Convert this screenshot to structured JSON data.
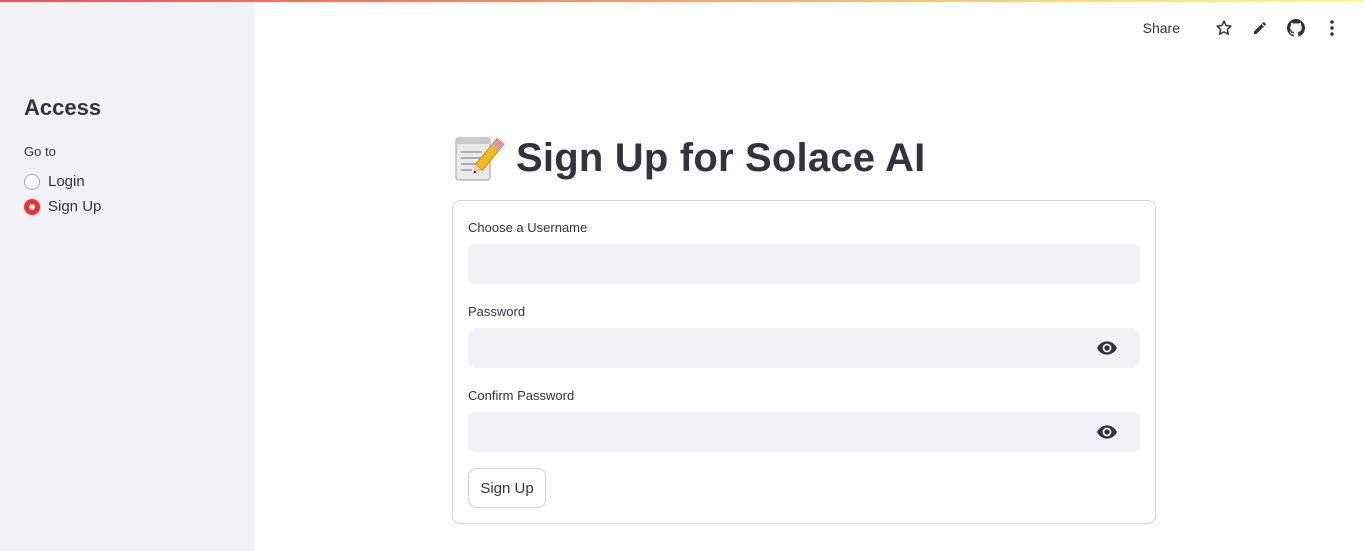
{
  "sidebar": {
    "title": "Access",
    "nav_label": "Go to",
    "options": [
      {
        "label": "Login",
        "selected": false
      },
      {
        "label": "Sign Up",
        "selected": true
      }
    ]
  },
  "toolbar": {
    "share_label": "Share",
    "icons": [
      "star-icon",
      "pencil-icon",
      "github-icon",
      "more-vertical-icon"
    ]
  },
  "main": {
    "title_emoji": "memo-icon",
    "title": "Sign Up for Solace AI",
    "form": {
      "username_label": "Choose a Username",
      "username_value": "",
      "password_label": "Password",
      "password_value": "",
      "confirm_label": "Confirm Password",
      "confirm_value": "",
      "submit_label": "Sign Up"
    }
  },
  "colors": {
    "accent": "#ff2b2b",
    "sidebar_bg": "#f0f2f6",
    "text": "#31333f",
    "input_bg": "#f0f2f6"
  }
}
